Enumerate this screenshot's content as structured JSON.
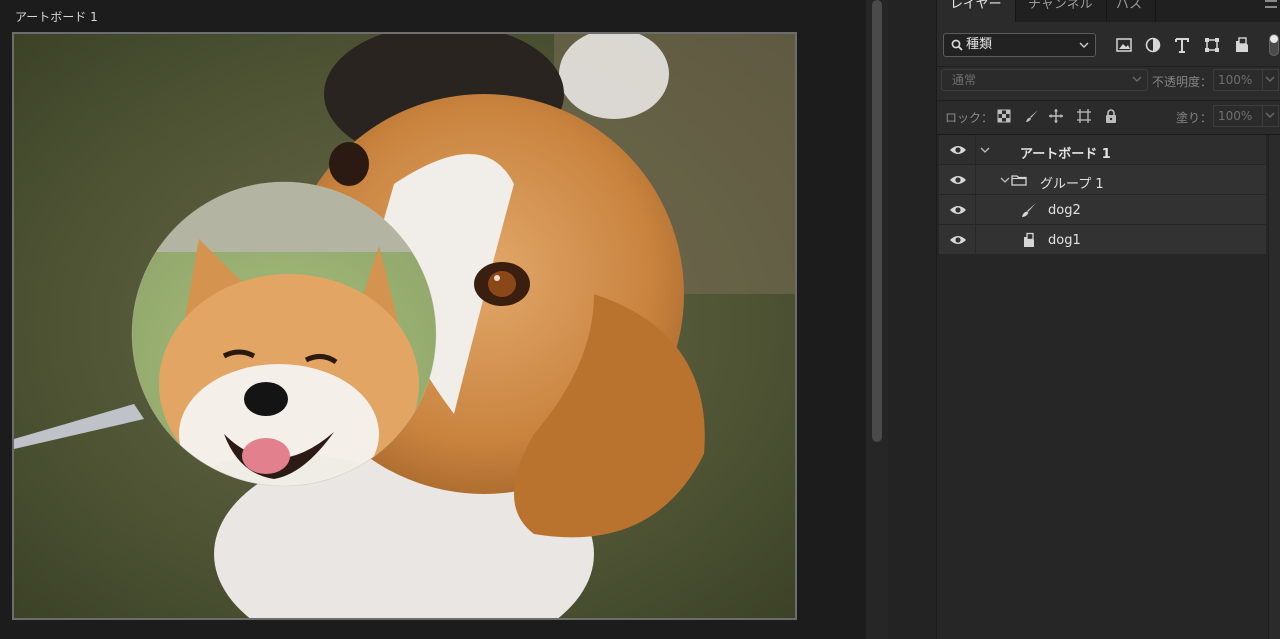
{
  "artboard": {
    "label": "アートボード 1"
  },
  "panel": {
    "tabs": [
      {
        "label": "レイヤー",
        "active": true
      },
      {
        "label": "チャンネル",
        "active": false
      },
      {
        "label": "パス",
        "active": false
      }
    ],
    "filter": {
      "kind_label": "種類",
      "icons": [
        "image-filter-icon",
        "adjustment-filter-icon",
        "type-filter-icon",
        "shape-filter-icon",
        "smart-object-filter-icon"
      ]
    },
    "blend": {
      "mode": "通常",
      "opacity_label": "不透明度：",
      "opacity_value": "100%"
    },
    "lock": {
      "label": "ロック：",
      "icons": [
        "lock-transparent-pixels-icon",
        "lock-image-pixels-icon",
        "lock-position-icon",
        "lock-artboard-icon",
        "lock-all-icon"
      ],
      "fill_label": "塗り：",
      "fill_value": "100%"
    },
    "layers": [
      {
        "name": "アートボード 1",
        "type": "artboard",
        "visible": true,
        "expanded": true
      },
      {
        "name": "グループ 1",
        "type": "group",
        "visible": true,
        "expanded": true
      },
      {
        "name": "dog2",
        "type": "pixel",
        "visible": true
      },
      {
        "name": "dog1",
        "type": "smart-object",
        "visible": true
      }
    ]
  },
  "colors": {
    "panel_bg": "#2b2b2b",
    "canvas_bg": "#1c1c1c",
    "layer_row": "#323232"
  }
}
